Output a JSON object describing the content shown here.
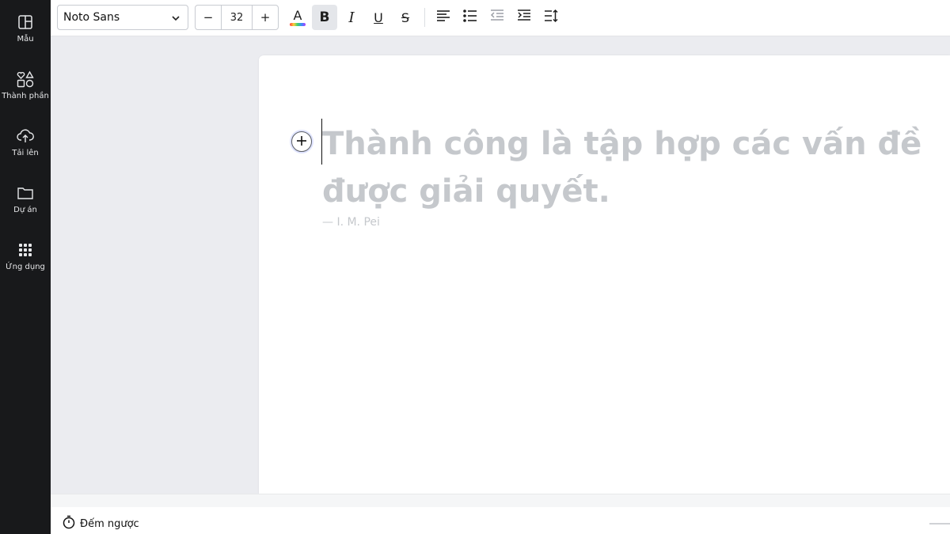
{
  "sidebar": {
    "items": [
      {
        "label": "Mẫu",
        "icon": "layout-icon"
      },
      {
        "label": "Thành phần",
        "icon": "shapes-icon"
      },
      {
        "label": "Tải lên",
        "icon": "upload-cloud-icon"
      },
      {
        "label": "Dự án",
        "icon": "folder-icon"
      },
      {
        "label": "Ứng dụng",
        "icon": "apps-grid-icon"
      }
    ]
  },
  "toolbar": {
    "font_family": "Noto Sans",
    "font_size": "32",
    "decrease_label": "−",
    "increase_label": "+",
    "bold_label": "B",
    "italic_label": "I",
    "underline_label": "U",
    "strike_label": "S",
    "text_color_letter": "A",
    "active_style": "bold"
  },
  "canvas": {
    "quote_text": "Thành công là tập hợp các vấn đề được giải quyết.",
    "author_text": "— I. M. Pei"
  },
  "bottom": {
    "timer_label": "Đếm ngược"
  },
  "colors": {
    "sidebar_bg": "#18191b",
    "placeholder_text": "#c5c8cc",
    "canvas_bg": "#ebecf0"
  }
}
